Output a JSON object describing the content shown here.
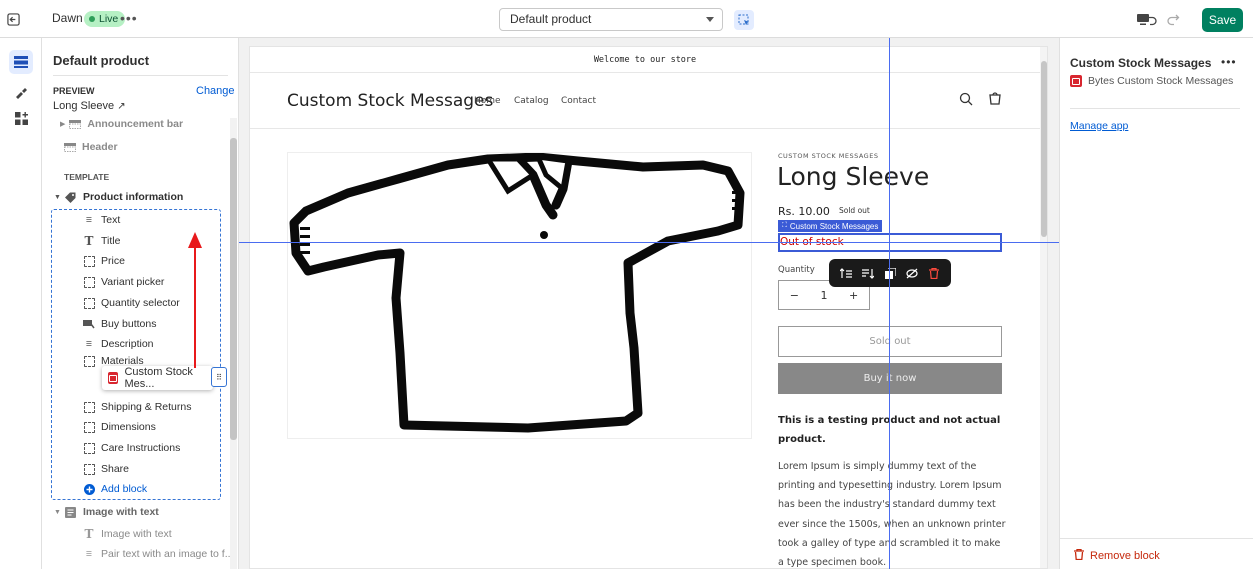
{
  "topbar": {
    "theme_name": "Dawn",
    "live_badge": "Live",
    "more": "•••",
    "template_select": "Default product",
    "save_label": "Save"
  },
  "left_panel": {
    "title": "Default product",
    "preview_label": "PREVIEW",
    "change_link": "Change",
    "preview_value": "Long Sleeve",
    "sections": {
      "announcement_bar": "Announcement bar",
      "header": "Header",
      "template_label": "TEMPLATE",
      "product_information": "Product information",
      "image_with_text": "Image with text"
    },
    "blocks": [
      "Text",
      "Title",
      "Price",
      "Variant picker",
      "Quantity selector",
      "Buy buttons",
      "Description",
      "Materials"
    ],
    "blocks_after": [
      "Shipping & Returns",
      "Dimensions",
      "Care Instructions",
      "Share"
    ],
    "add_block": "Add block",
    "dragging_item": "Custom Stock Mes...",
    "image_with_text_children": [
      "Image with text",
      "Pair text with an image to f..."
    ]
  },
  "preview": {
    "announcement": "Welcome to our store",
    "store_name": "Custom Stock Messages",
    "nav": [
      "Home",
      "Catalog",
      "Contact"
    ],
    "product": {
      "vendor": "CUSTOM STOCK MESSAGES",
      "title": "Long Sleeve",
      "price": "Rs. 10.00",
      "sold_out_badge": "Sold out",
      "block_tag": "Custom Stock Messages",
      "stock_message": "Out of stock",
      "quantity_label": "Quantity",
      "quantity_value": "1",
      "minus": "−",
      "plus": "+",
      "sold_out_button": "Sold out",
      "buy_now_button": "Buy it now",
      "description_bold": "This is a testing product and not actual product.",
      "description_body": "Lorem Ipsum is simply dummy text of the printing and typesetting industry. Lorem Ipsum has been the industry's standard dummy text ever since the 1500s, when an unknown printer took a galley of type and scrambled it to make a type specimen book."
    }
  },
  "right_panel": {
    "title": "Custom Stock Messages",
    "more": "•••",
    "app_name": "Bytes Custom Stock Messages",
    "manage_app": "Manage app",
    "remove_block": "Remove block"
  },
  "colors": {
    "accent": "#005bd3",
    "save": "#008060",
    "selection": "#3b5bd6",
    "danger": "#c5280c",
    "stock_message": "#cc0000"
  }
}
